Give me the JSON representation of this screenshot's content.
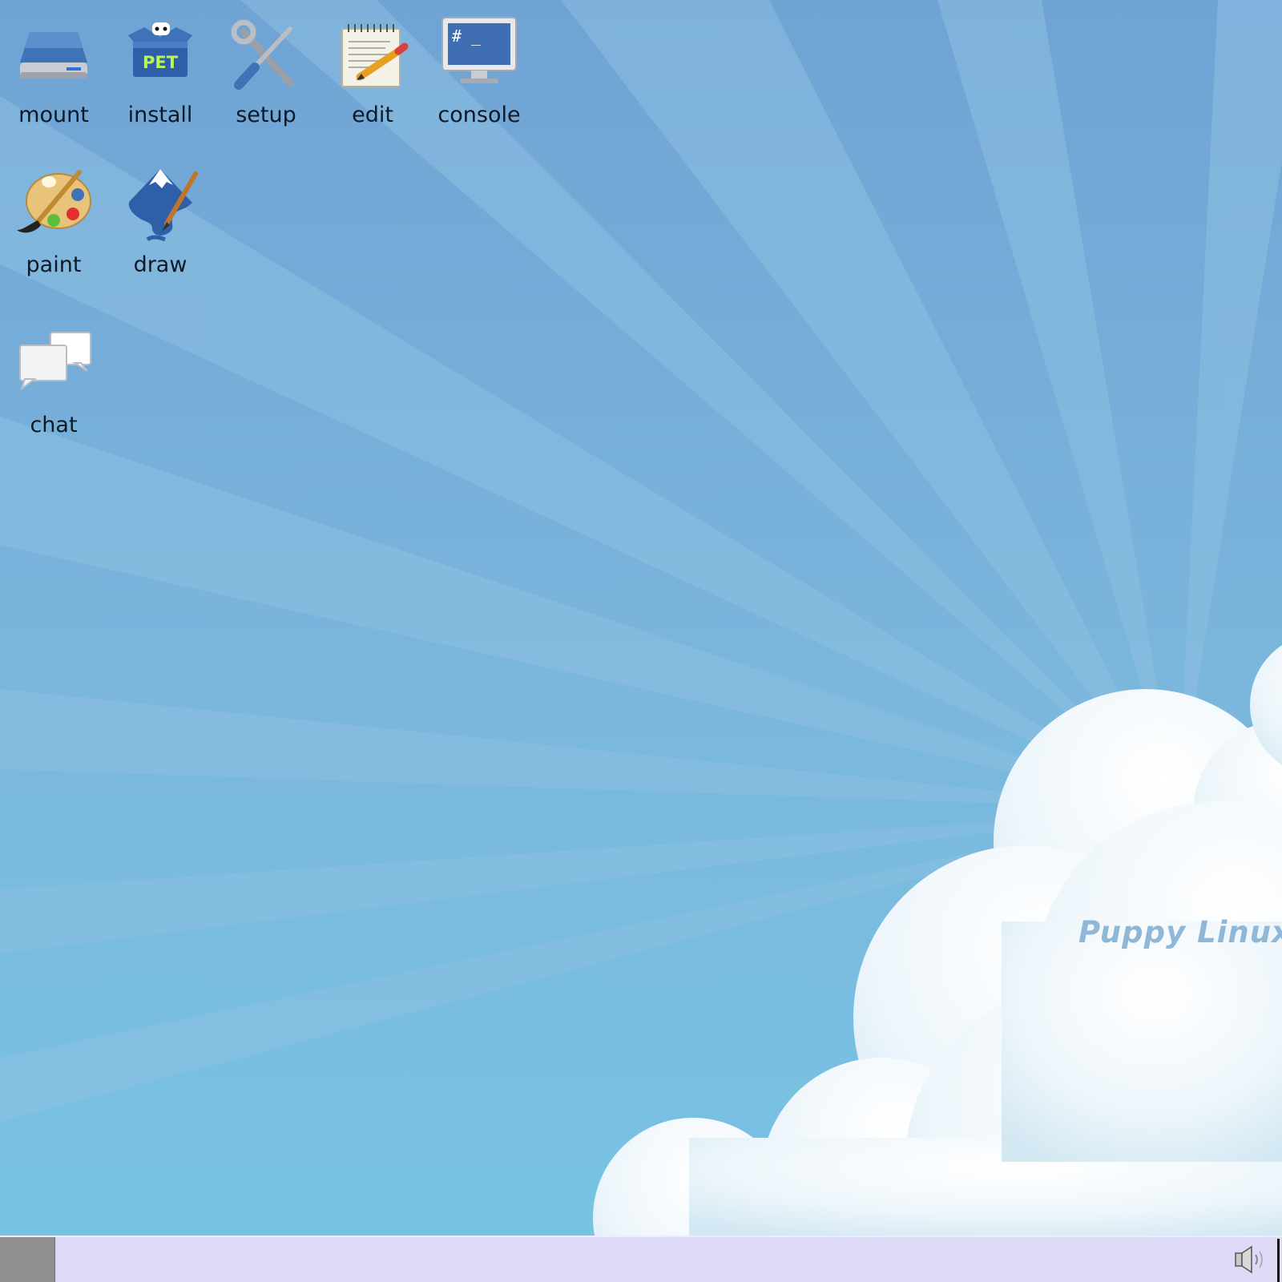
{
  "desktop": {
    "icons": [
      {
        "id": "mount",
        "label": "mount",
        "icon": "drive-icon"
      },
      {
        "id": "install",
        "label": "install",
        "icon": "pet-package-icon",
        "badge": "PET"
      },
      {
        "id": "setup",
        "label": "setup",
        "icon": "tools-icon"
      },
      {
        "id": "edit",
        "label": "edit",
        "icon": "notepad-pencil-icon"
      },
      {
        "id": "console",
        "label": "console",
        "icon": "terminal-monitor-icon",
        "prompt": "# _"
      },
      {
        "id": "paint",
        "label": "paint",
        "icon": "paint-palette-icon"
      },
      {
        "id": "draw",
        "label": "draw",
        "icon": "inkscape-icon"
      },
      {
        "id": "chat",
        "label": "chat",
        "icon": "chat-bubbles-icon"
      }
    ],
    "wallpaper_text": "Puppy Linux"
  },
  "taskbar": {
    "menu_icon": "menu-button",
    "tray_icons": [
      "volume-icon"
    ]
  },
  "colors": {
    "sky_top": "#6fa3d4",
    "sky_bottom": "#78c3e3",
    "ray": "#8cc0e2",
    "taskbar": "#dcdaf6",
    "menu_button": "#8f8f8f",
    "brand_text": "#8fb8d8"
  }
}
